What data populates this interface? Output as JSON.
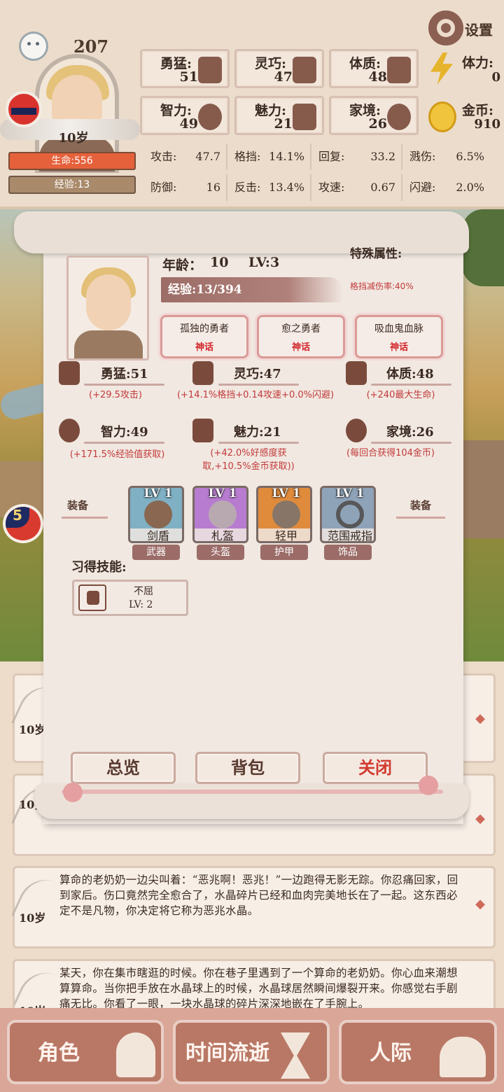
{
  "header": {
    "top_number": "207",
    "age": "10岁",
    "hp": "生命:556",
    "xp": "经验:13",
    "settings_label": "设置",
    "attributes": [
      {
        "name": "勇猛:",
        "value": "51",
        "icon": "fist-icon"
      },
      {
        "name": "灵巧:",
        "value": "47",
        "icon": "cloak-icon"
      },
      {
        "name": "体质:",
        "value": "48",
        "icon": "muscle-arm-icon"
      },
      {
        "name": "智力:",
        "value": "49",
        "icon": "brain-head-icon"
      },
      {
        "name": "魅力:",
        "value": "21",
        "icon": "flower-icon"
      },
      {
        "name": "家境:",
        "value": "26",
        "icon": "house-icon"
      }
    ],
    "stamina": {
      "name": "体力:",
      "value": "0",
      "icon": "lightning-icon",
      "color": "#e6b42c"
    },
    "gold": {
      "name": "金币:",
      "value": "910",
      "icon": "gold-coin-icon",
      "color": "#f0c43c"
    },
    "combat": [
      {
        "k": "攻击:",
        "v": "47.7"
      },
      {
        "k": "格挡:",
        "v": "14.1%"
      },
      {
        "k": "回复:",
        "v": "33.2"
      },
      {
        "k": "溅伤:",
        "v": "6.5%"
      },
      {
        "k": "防御:",
        "v": "16"
      },
      {
        "k": "反击:",
        "v": "13.4%"
      },
      {
        "k": "攻速:",
        "v": "0.67"
      },
      {
        "k": "闪避:",
        "v": "2.0%"
      }
    ]
  },
  "side": {
    "stage_number": "5"
  },
  "sheet": {
    "age_label": "年龄：",
    "age_value": "10",
    "level": "LV:3",
    "special_title": "特殊属性:",
    "special_note": "格挡减伤率:40%",
    "xp_text": "经验:13/394",
    "traits": [
      {
        "name": "孤独的勇者",
        "rarity": "神话"
      },
      {
        "name": "愈之勇者",
        "rarity": "神话"
      },
      {
        "name": "吸血鬼血脉",
        "rarity": "神话"
      }
    ],
    "stats": [
      {
        "name": "勇猛:51",
        "desc": "(+29.5攻击)",
        "icon": "fist-icon"
      },
      {
        "name": "灵巧:47",
        "desc": "(+14.1%格挡+0.14攻速+0.0%闪避)",
        "icon": "cloak-icon"
      },
      {
        "name": "体质:48",
        "desc": "(+240最大生命)",
        "icon": "muscle-arm-icon"
      },
      {
        "name": "智力:49",
        "desc": "(+171.5%经验值获取)",
        "icon": "brain-head-icon"
      },
      {
        "name": "魅力:21",
        "desc": "(+42.0%好感度获取,+10.5%金币获取))",
        "icon": "flower-icon"
      },
      {
        "name": "家境:26",
        "desc": "(每回合获得104金币)",
        "icon": "house-icon"
      }
    ],
    "equip_label_left": "装备",
    "equip_label_right": "装备",
    "equipment": [
      {
        "lv": "LV 1",
        "name": "剑盾",
        "category": "武器",
        "color": "#7fb0c4"
      },
      {
        "lv": "LV 1",
        "name": "札盔",
        "category": "头盔",
        "color": "#b77ccf"
      },
      {
        "lv": "LV 1",
        "name": "轻甲",
        "category": "护甲",
        "color": "#e08b3c"
      },
      {
        "lv": "LV 1",
        "name": "范围戒指",
        "category": "饰品",
        "color": "#8fa3b8"
      }
    ],
    "skills_title": "习得技能:",
    "skills": [
      {
        "name": "不屈",
        "level": "LV: 2"
      }
    ],
    "buttons": {
      "overview": "总览",
      "bag": "背包",
      "close": "关闭"
    }
  },
  "log": [
    {
      "age": "10岁",
      "text": ""
    },
    {
      "age": "10岁",
      "text": ""
    },
    {
      "age": "10岁",
      "text": "算命的老奶奶一边尖叫着：“恶兆啊！恶兆！”一边跑得无影无踪。你忍痛回家，回到家后。伤口竟然完全愈合了，水晶碎片已经和血肉完美地长在了一起。这东西必定不是凡物，你决定将它称为恶兆水晶。"
    },
    {
      "age": "10岁",
      "text": "某天，你在集市瞎逛的时候。你在巷子里遇到了一个算命的老奶奶。你心血来潮想算算命。当你把手放在水晶球上的时候，水晶球居然瞬间爆裂开来。你感觉右手剧痛无比。你看了一眼，一块水晶球的碎片深深地嵌在了手腕上。"
    }
  ],
  "nav": {
    "character": "角色",
    "time": "时间流逝",
    "social": "人际"
  }
}
